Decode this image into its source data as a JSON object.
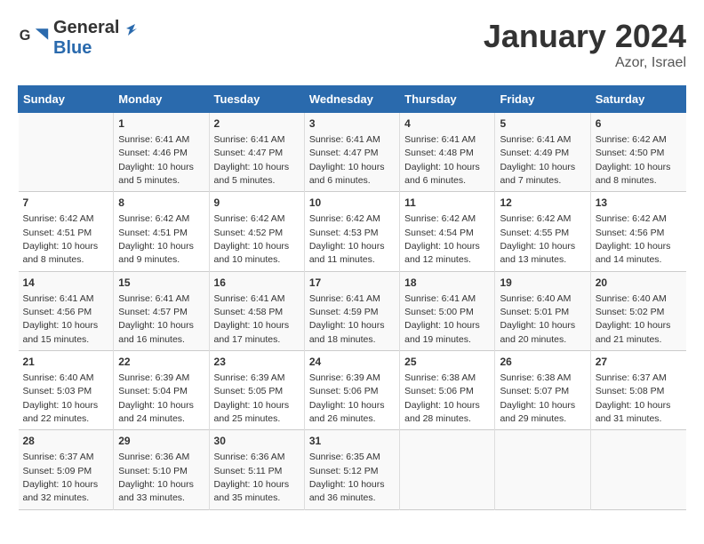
{
  "header": {
    "logo_line1": "General",
    "logo_line2": "Blue",
    "month_title": "January 2024",
    "location": "Azor, Israel"
  },
  "days_of_week": [
    "Sunday",
    "Monday",
    "Tuesday",
    "Wednesday",
    "Thursday",
    "Friday",
    "Saturday"
  ],
  "weeks": [
    [
      {
        "num": "",
        "sunrise": "",
        "sunset": "",
        "daylight": ""
      },
      {
        "num": "1",
        "sunrise": "Sunrise: 6:41 AM",
        "sunset": "Sunset: 4:46 PM",
        "daylight": "Daylight: 10 hours and 5 minutes."
      },
      {
        "num": "2",
        "sunrise": "Sunrise: 6:41 AM",
        "sunset": "Sunset: 4:47 PM",
        "daylight": "Daylight: 10 hours and 5 minutes."
      },
      {
        "num": "3",
        "sunrise": "Sunrise: 6:41 AM",
        "sunset": "Sunset: 4:47 PM",
        "daylight": "Daylight: 10 hours and 6 minutes."
      },
      {
        "num": "4",
        "sunrise": "Sunrise: 6:41 AM",
        "sunset": "Sunset: 4:48 PM",
        "daylight": "Daylight: 10 hours and 6 minutes."
      },
      {
        "num": "5",
        "sunrise": "Sunrise: 6:41 AM",
        "sunset": "Sunset: 4:49 PM",
        "daylight": "Daylight: 10 hours and 7 minutes."
      },
      {
        "num": "6",
        "sunrise": "Sunrise: 6:42 AM",
        "sunset": "Sunset: 4:50 PM",
        "daylight": "Daylight: 10 hours and 8 minutes."
      }
    ],
    [
      {
        "num": "7",
        "sunrise": "Sunrise: 6:42 AM",
        "sunset": "Sunset: 4:51 PM",
        "daylight": "Daylight: 10 hours and 8 minutes."
      },
      {
        "num": "8",
        "sunrise": "Sunrise: 6:42 AM",
        "sunset": "Sunset: 4:51 PM",
        "daylight": "Daylight: 10 hours and 9 minutes."
      },
      {
        "num": "9",
        "sunrise": "Sunrise: 6:42 AM",
        "sunset": "Sunset: 4:52 PM",
        "daylight": "Daylight: 10 hours and 10 minutes."
      },
      {
        "num": "10",
        "sunrise": "Sunrise: 6:42 AM",
        "sunset": "Sunset: 4:53 PM",
        "daylight": "Daylight: 10 hours and 11 minutes."
      },
      {
        "num": "11",
        "sunrise": "Sunrise: 6:42 AM",
        "sunset": "Sunset: 4:54 PM",
        "daylight": "Daylight: 10 hours and 12 minutes."
      },
      {
        "num": "12",
        "sunrise": "Sunrise: 6:42 AM",
        "sunset": "Sunset: 4:55 PM",
        "daylight": "Daylight: 10 hours and 13 minutes."
      },
      {
        "num": "13",
        "sunrise": "Sunrise: 6:42 AM",
        "sunset": "Sunset: 4:56 PM",
        "daylight": "Daylight: 10 hours and 14 minutes."
      }
    ],
    [
      {
        "num": "14",
        "sunrise": "Sunrise: 6:41 AM",
        "sunset": "Sunset: 4:56 PM",
        "daylight": "Daylight: 10 hours and 15 minutes."
      },
      {
        "num": "15",
        "sunrise": "Sunrise: 6:41 AM",
        "sunset": "Sunset: 4:57 PM",
        "daylight": "Daylight: 10 hours and 16 minutes."
      },
      {
        "num": "16",
        "sunrise": "Sunrise: 6:41 AM",
        "sunset": "Sunset: 4:58 PM",
        "daylight": "Daylight: 10 hours and 17 minutes."
      },
      {
        "num": "17",
        "sunrise": "Sunrise: 6:41 AM",
        "sunset": "Sunset: 4:59 PM",
        "daylight": "Daylight: 10 hours and 18 minutes."
      },
      {
        "num": "18",
        "sunrise": "Sunrise: 6:41 AM",
        "sunset": "Sunset: 5:00 PM",
        "daylight": "Daylight: 10 hours and 19 minutes."
      },
      {
        "num": "19",
        "sunrise": "Sunrise: 6:40 AM",
        "sunset": "Sunset: 5:01 PM",
        "daylight": "Daylight: 10 hours and 20 minutes."
      },
      {
        "num": "20",
        "sunrise": "Sunrise: 6:40 AM",
        "sunset": "Sunset: 5:02 PM",
        "daylight": "Daylight: 10 hours and 21 minutes."
      }
    ],
    [
      {
        "num": "21",
        "sunrise": "Sunrise: 6:40 AM",
        "sunset": "Sunset: 5:03 PM",
        "daylight": "Daylight: 10 hours and 22 minutes."
      },
      {
        "num": "22",
        "sunrise": "Sunrise: 6:39 AM",
        "sunset": "Sunset: 5:04 PM",
        "daylight": "Daylight: 10 hours and 24 minutes."
      },
      {
        "num": "23",
        "sunrise": "Sunrise: 6:39 AM",
        "sunset": "Sunset: 5:05 PM",
        "daylight": "Daylight: 10 hours and 25 minutes."
      },
      {
        "num": "24",
        "sunrise": "Sunrise: 6:39 AM",
        "sunset": "Sunset: 5:06 PM",
        "daylight": "Daylight: 10 hours and 26 minutes."
      },
      {
        "num": "25",
        "sunrise": "Sunrise: 6:38 AM",
        "sunset": "Sunset: 5:06 PM",
        "daylight": "Daylight: 10 hours and 28 minutes."
      },
      {
        "num": "26",
        "sunrise": "Sunrise: 6:38 AM",
        "sunset": "Sunset: 5:07 PM",
        "daylight": "Daylight: 10 hours and 29 minutes."
      },
      {
        "num": "27",
        "sunrise": "Sunrise: 6:37 AM",
        "sunset": "Sunset: 5:08 PM",
        "daylight": "Daylight: 10 hours and 31 minutes."
      }
    ],
    [
      {
        "num": "28",
        "sunrise": "Sunrise: 6:37 AM",
        "sunset": "Sunset: 5:09 PM",
        "daylight": "Daylight: 10 hours and 32 minutes."
      },
      {
        "num": "29",
        "sunrise": "Sunrise: 6:36 AM",
        "sunset": "Sunset: 5:10 PM",
        "daylight": "Daylight: 10 hours and 33 minutes."
      },
      {
        "num": "30",
        "sunrise": "Sunrise: 6:36 AM",
        "sunset": "Sunset: 5:11 PM",
        "daylight": "Daylight: 10 hours and 35 minutes."
      },
      {
        "num": "31",
        "sunrise": "Sunrise: 6:35 AM",
        "sunset": "Sunset: 5:12 PM",
        "daylight": "Daylight: 10 hours and 36 minutes."
      },
      {
        "num": "",
        "sunrise": "",
        "sunset": "",
        "daylight": ""
      },
      {
        "num": "",
        "sunrise": "",
        "sunset": "",
        "daylight": ""
      },
      {
        "num": "",
        "sunrise": "",
        "sunset": "",
        "daylight": ""
      }
    ]
  ]
}
